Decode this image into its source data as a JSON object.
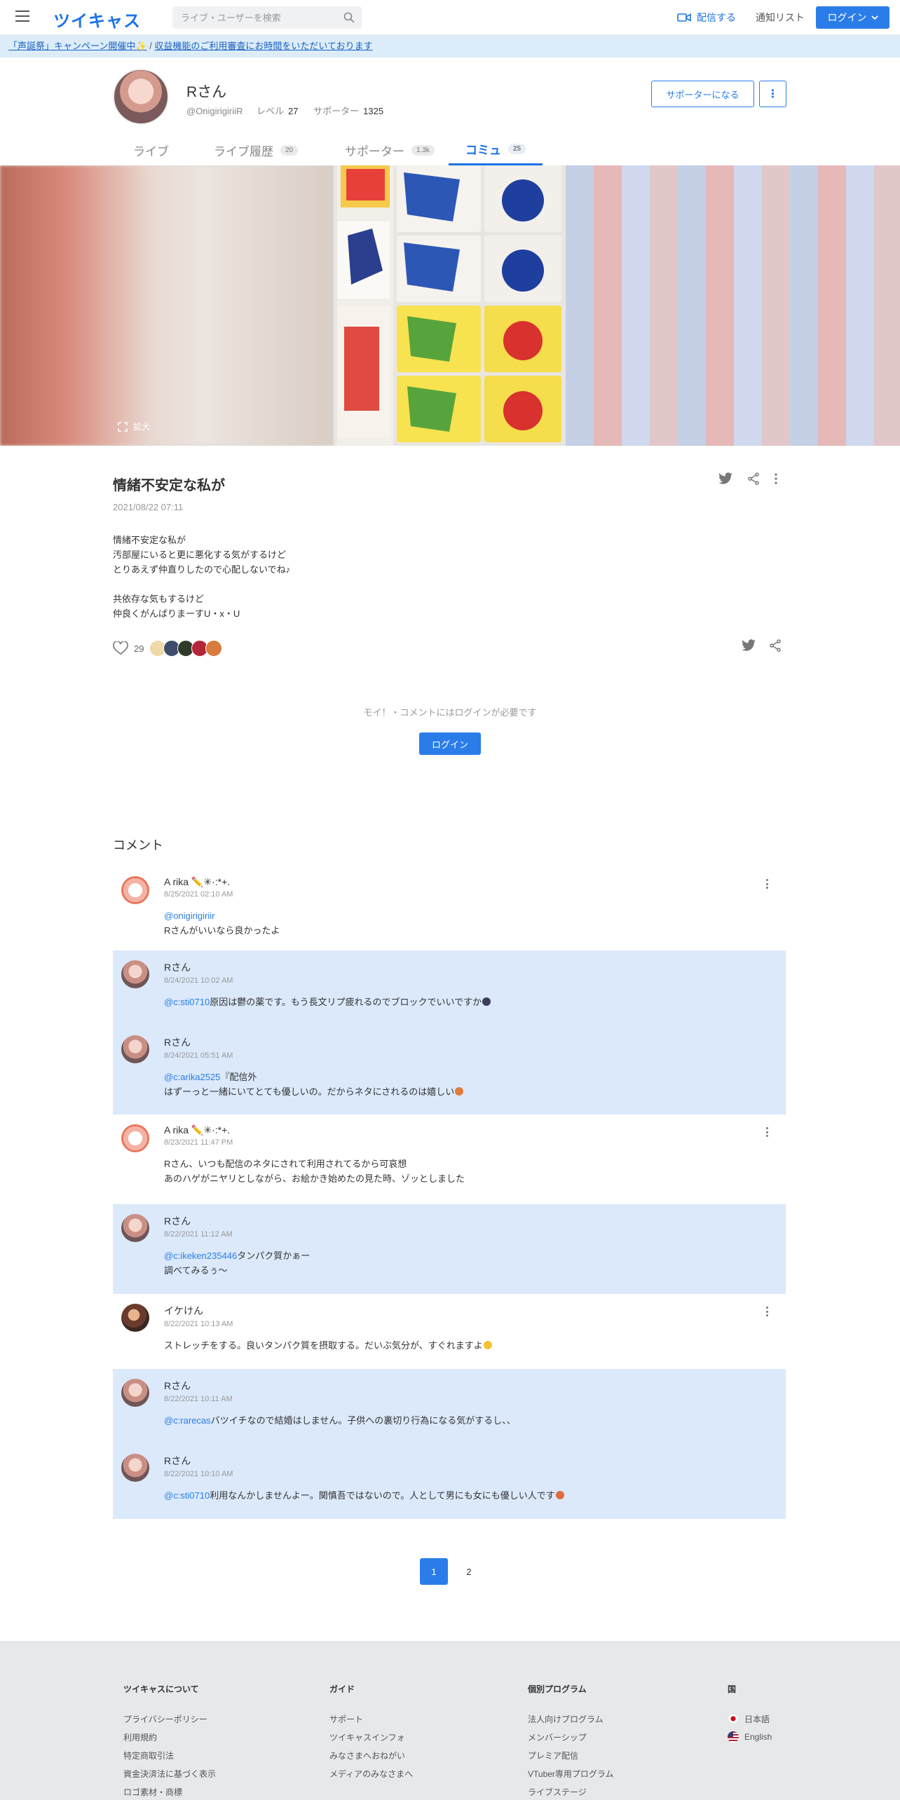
{
  "header": {
    "logo": "ツイキャス",
    "search_placeholder": "ライブ・ユーザーを検索",
    "broadcast": "配信する",
    "notify": "通知リスト",
    "login": "ログイン"
  },
  "notice": {
    "link1": "「声誕祭」キャンペーン開催中✨",
    "sep": " / ",
    "link2": "収益機能のご利用審査にお時間をいただいております"
  },
  "profile": {
    "name": "Rさん",
    "handle": "@OnigirigiriiR",
    "level_label": "レベル",
    "level": "27",
    "supporters_label": "サポーター",
    "supporters": "1325",
    "support_button": "サポーターになる",
    "more_button": "⋮"
  },
  "tabs": [
    {
      "label": "ライブ",
      "count": ""
    },
    {
      "label": "ライブ履歴",
      "count": "20"
    },
    {
      "label": "サポーター",
      "count": "1.3k"
    },
    {
      "label": "コミュ",
      "count": "25"
    }
  ],
  "hero": {
    "zoom_label": "拡大"
  },
  "post": {
    "title": "情緒不安定な私が",
    "date": "2021/08/22 07:11",
    "body": "情緒不安定な私が\n汚部屋にいると更に悪化する気がするけど\nとりあえず仲直りしたので心配しないでね♪\n\n共依存な気もするけど\n仲良くがんばりまーすU・x・U",
    "likes": "29"
  },
  "login_prompt": {
    "message": "モイ！・コメントにはログインが必要です",
    "button": "ログイン"
  },
  "comments_title": "コメント",
  "comments": [
    {
      "name": "A rika ✏️✳︎·:*+.",
      "date": "8/25/2021 02:10 AM",
      "mention": "@onigirigiriir",
      "text": "Rさんがいいなら良かったよ",
      "own": false
    },
    {
      "name": "Rさん",
      "date": "8/24/2021 10:02 AM",
      "mention": "@c:sti0710",
      "text": "原因は鬱の薬です。もう長文リプ疲れるのでブロックでいいですか",
      "own": true
    },
    {
      "name": "Rさん",
      "date": "8/24/2021 05:51 AM",
      "mention": "@c:arika2525",
      "text": "『配信外\nはずーっと一緒にいてとても優しいの。だからネタにされるのは嬉しい",
      "own": true
    },
    {
      "name": "A rika ✏️✳︎·:*+.",
      "date": "8/23/2021 11:47 PM",
      "mention": "",
      "text": "Rさん、いつも配信のネタにされて利用されてるから可哀想\nあのハゲがニヤリとしながら、お絵かき始めたの見た時、ゾッとしました",
      "own": false
    },
    {
      "name": "Rさん",
      "date": "8/22/2021 11:12 AM",
      "mention": "@c:ikeken235446",
      "text": "タンパク質かぁー\n調べてみるぅ〜",
      "own": true
    },
    {
      "name": "イケけん",
      "date": "8/22/2021 10:13 AM",
      "mention": "",
      "text": "ストレッチをする。良いタンパク質を摂取する。だいぶ気分が、すぐれますよ",
      "own": false
    },
    {
      "name": "Rさん",
      "date": "8/22/2021 10:11 AM",
      "mention": "@c:rarecas",
      "text": "バツイチなので結婚はしません。子供への裏切り行為になる気がするし、、",
      "own": true
    },
    {
      "name": "Rさん",
      "date": "8/22/2021 10:10 AM",
      "mention": "@c:sti0710",
      "text": "利用なんかしませんよー。関慎吾ではないので。人として男にも女にも優しい人です",
      "own": true
    }
  ],
  "pager": [
    "1",
    "2"
  ],
  "footer": {
    "col1": {
      "title": "ツイキャスについて",
      "items": [
        "プライバシーポリシー",
        "利用規約",
        "特定商取引法",
        "資金決済法に基づく表示",
        "ロゴ素材・商標"
      ]
    },
    "col2": {
      "title": "ガイド",
      "items": [
        "サポート",
        "ツイキャスインフォ",
        "みなさまへおねがい",
        "メディアのみなさまへ"
      ]
    },
    "col3": {
      "title": "個別プログラム",
      "items": [
        "法人向けプログラム",
        "メンバーシップ",
        "プレミア配信",
        "VTuber専用プログラム",
        "ライブステージ"
      ]
    },
    "col4": {
      "title": "国",
      "items": [
        "日本語",
        "English"
      ]
    }
  },
  "colors": {
    "accent": "#2a7de9",
    "highlight": "#dbe9fb",
    "notice": "#dcedf9"
  }
}
